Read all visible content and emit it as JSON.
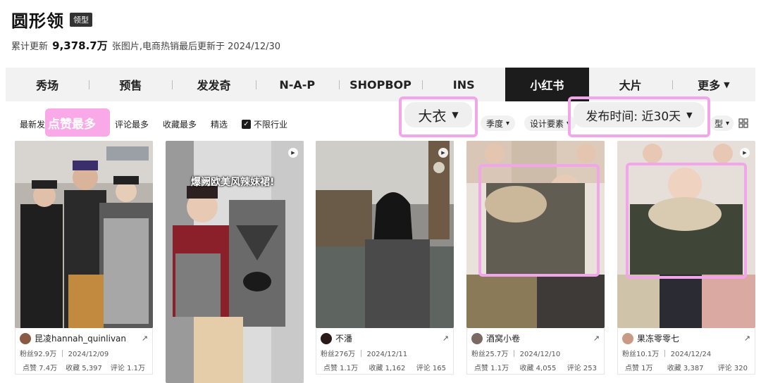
{
  "header": {
    "title": "圆形领",
    "tag": "领型",
    "stats_prefix": "累计更新",
    "stats_count": "9,378.7万",
    "stats_suffix": "张图片,电商热销最后更新于 2024/12/30"
  },
  "nav": {
    "tabs": [
      {
        "label": "秀场"
      },
      {
        "label": "预售"
      },
      {
        "label": "发发奇"
      },
      {
        "label": "N-A-P"
      },
      {
        "label": "SHOPBOP"
      },
      {
        "label": "INS"
      },
      {
        "label": "小红书",
        "active": true
      },
      {
        "label": "大片"
      },
      {
        "label": "更多"
      }
    ],
    "more_caret": "▼"
  },
  "filters": {
    "sort_options": [
      "最新发",
      "点赞最多",
      "评论最多",
      "收藏最多",
      "精选"
    ],
    "checkbox_label": "不限行业",
    "category": "大衣",
    "season": "季度",
    "design": "设计要素",
    "publish_time": "发布时间:  近30天",
    "type_partial": "型",
    "caret": "▾",
    "caret_big": "▼",
    "check_mark": "✓",
    "grid_icon": "grid-view-icon"
  },
  "cards": [
    {
      "author": "昆凌hannah_quinlivan",
      "fans": "粉丝92.9万",
      "date": "2024/12/09",
      "likes": "点赞 7.4万",
      "saves": "收藏 5,397",
      "comments": "评论 1.1万",
      "video": false
    },
    {
      "overlay": "爆阙欧美风辣妹裙!",
      "video": true
    },
    {
      "author": "不潘",
      "fans": "粉丝276万",
      "date": "2024/12/11",
      "likes": "点赞 1.1万",
      "saves": "收藏 1,162",
      "comments": "评论 165",
      "video": true
    },
    {
      "author": "酒窝小卷",
      "fans": "粉丝25.7万",
      "date": "2024/12/10",
      "likes": "点赞 1.1万",
      "saves": "收藏 4,055",
      "comments": "评论 253",
      "video": false
    },
    {
      "author": "果冻零零七",
      "fans": "粉丝10.1万",
      "date": "2024/12/24",
      "likes": "点赞 1万",
      "saves": "收藏 3,387",
      "comments": "评论 320",
      "video": true
    }
  ],
  "icons": {
    "share": "↗",
    "play": "▶"
  },
  "colors": {
    "highlight": "#f2a6ea",
    "active_tab": "#1c1c1c"
  }
}
